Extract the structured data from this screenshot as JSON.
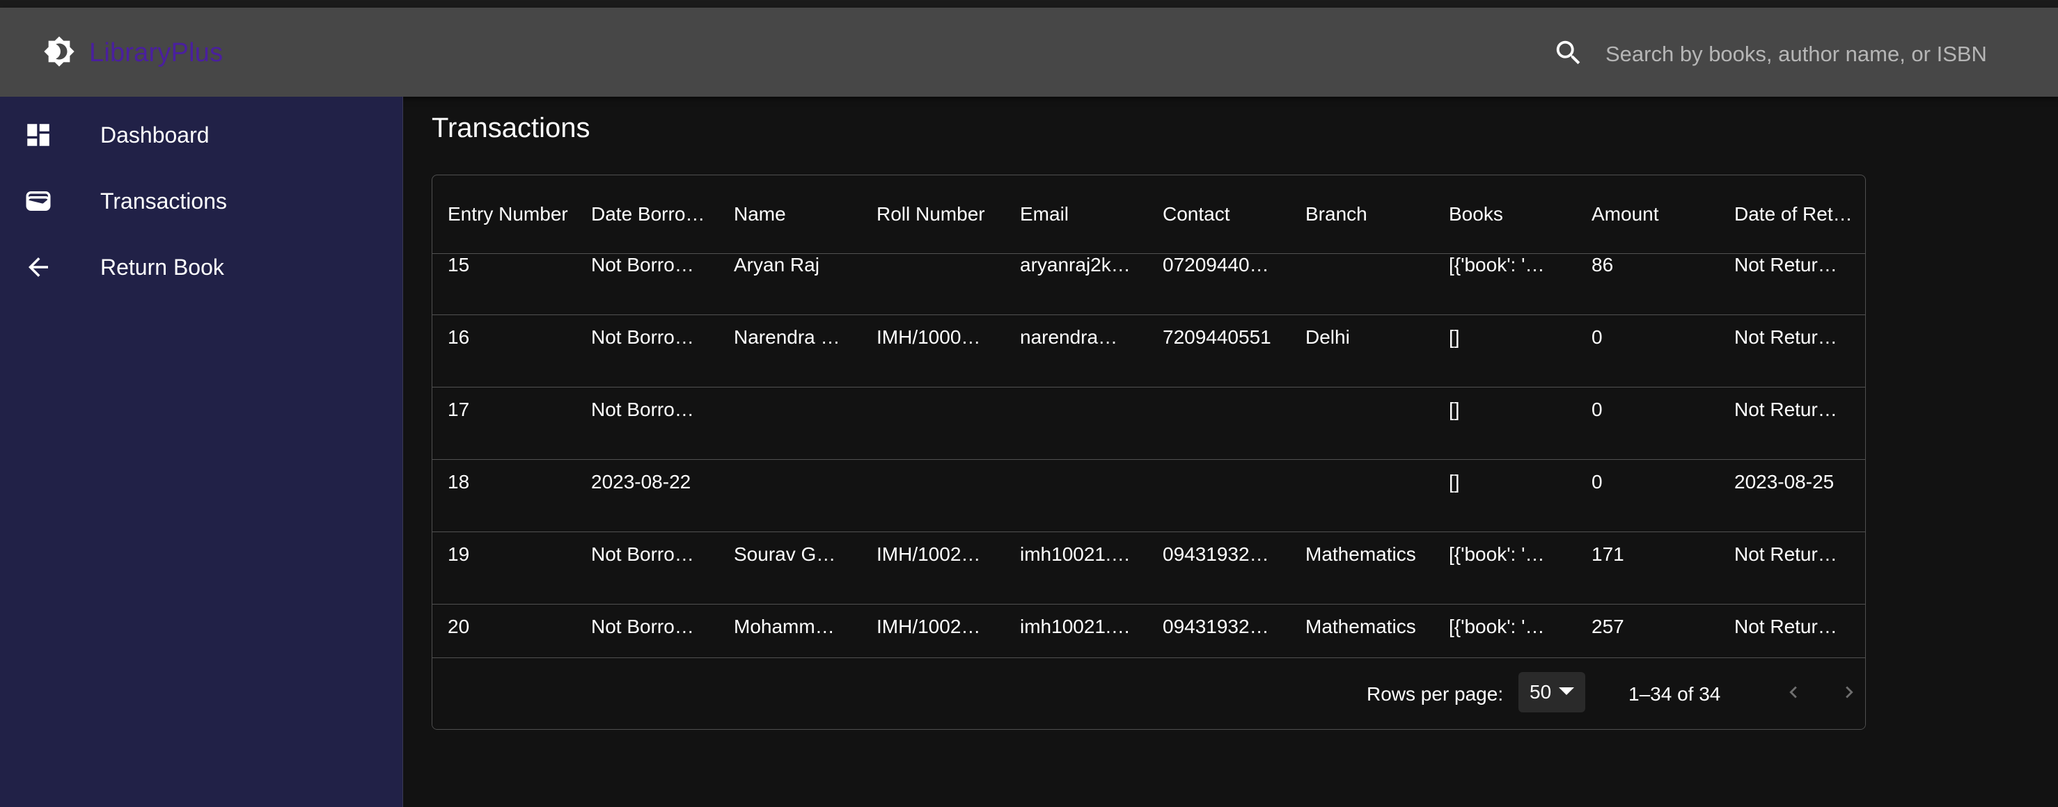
{
  "app": {
    "brand": "LibraryPlus",
    "search_placeholder": "Search by books, author name, or ISBN"
  },
  "sidebar": {
    "items": [
      {
        "label": "Dashboard",
        "icon": "dashboard-icon"
      },
      {
        "label": "Transactions",
        "icon": "wallet-icon"
      },
      {
        "label": "Return Book",
        "icon": "arrow-back-icon"
      }
    ]
  },
  "page": {
    "title": "Transactions"
  },
  "table": {
    "columns": [
      "Entry Number",
      "Date Borrowed",
      "Name",
      "Roll Number",
      "Email",
      "Contact",
      "Branch",
      "Books",
      "Amount",
      "Date of Return"
    ],
    "rows": [
      [
        "15",
        "Not Borrowed",
        "Aryan Raj",
        "",
        "aryanraj2k…",
        "07209440…",
        "",
        "[{'book': '…",
        "86",
        "Not Returned"
      ],
      [
        "16",
        "Not Borrowed",
        "Narendra …",
        "IMH/1000…",
        "narendra…",
        "7209440551",
        "Delhi",
        "[]",
        "0",
        "Not Returned"
      ],
      [
        "17",
        "Not Borrowed",
        "",
        "",
        "",
        "",
        "",
        "[]",
        "0",
        "Not Returned"
      ],
      [
        "18",
        "2023-08-22",
        "",
        "",
        "",
        "",
        "",
        "[]",
        "0",
        "2023-08-25"
      ],
      [
        "19",
        "Not Borrowed",
        "Sourav Ga…",
        "IMH/1002…",
        "imh10021.…",
        "09431932…",
        "Mathematics",
        "[{'book': '…",
        "171",
        "Not Returned"
      ],
      [
        "20",
        "Not Borrowed",
        "Mohamma…",
        "IMH/1002…",
        "imh10021.…",
        "09431932…",
        "Mathematics",
        "[{'book': '…",
        "257",
        "Not Returned"
      ]
    ]
  },
  "pagination": {
    "rows_per_page_label": "Rows per page:",
    "rows_per_page_value": "50",
    "range_label": "1–34 of 34"
  },
  "colors": {
    "header_bg": "#474747",
    "sidebar_bg": "#212147",
    "brand_text": "#4a1f9e",
    "page_bg": "#121212"
  }
}
